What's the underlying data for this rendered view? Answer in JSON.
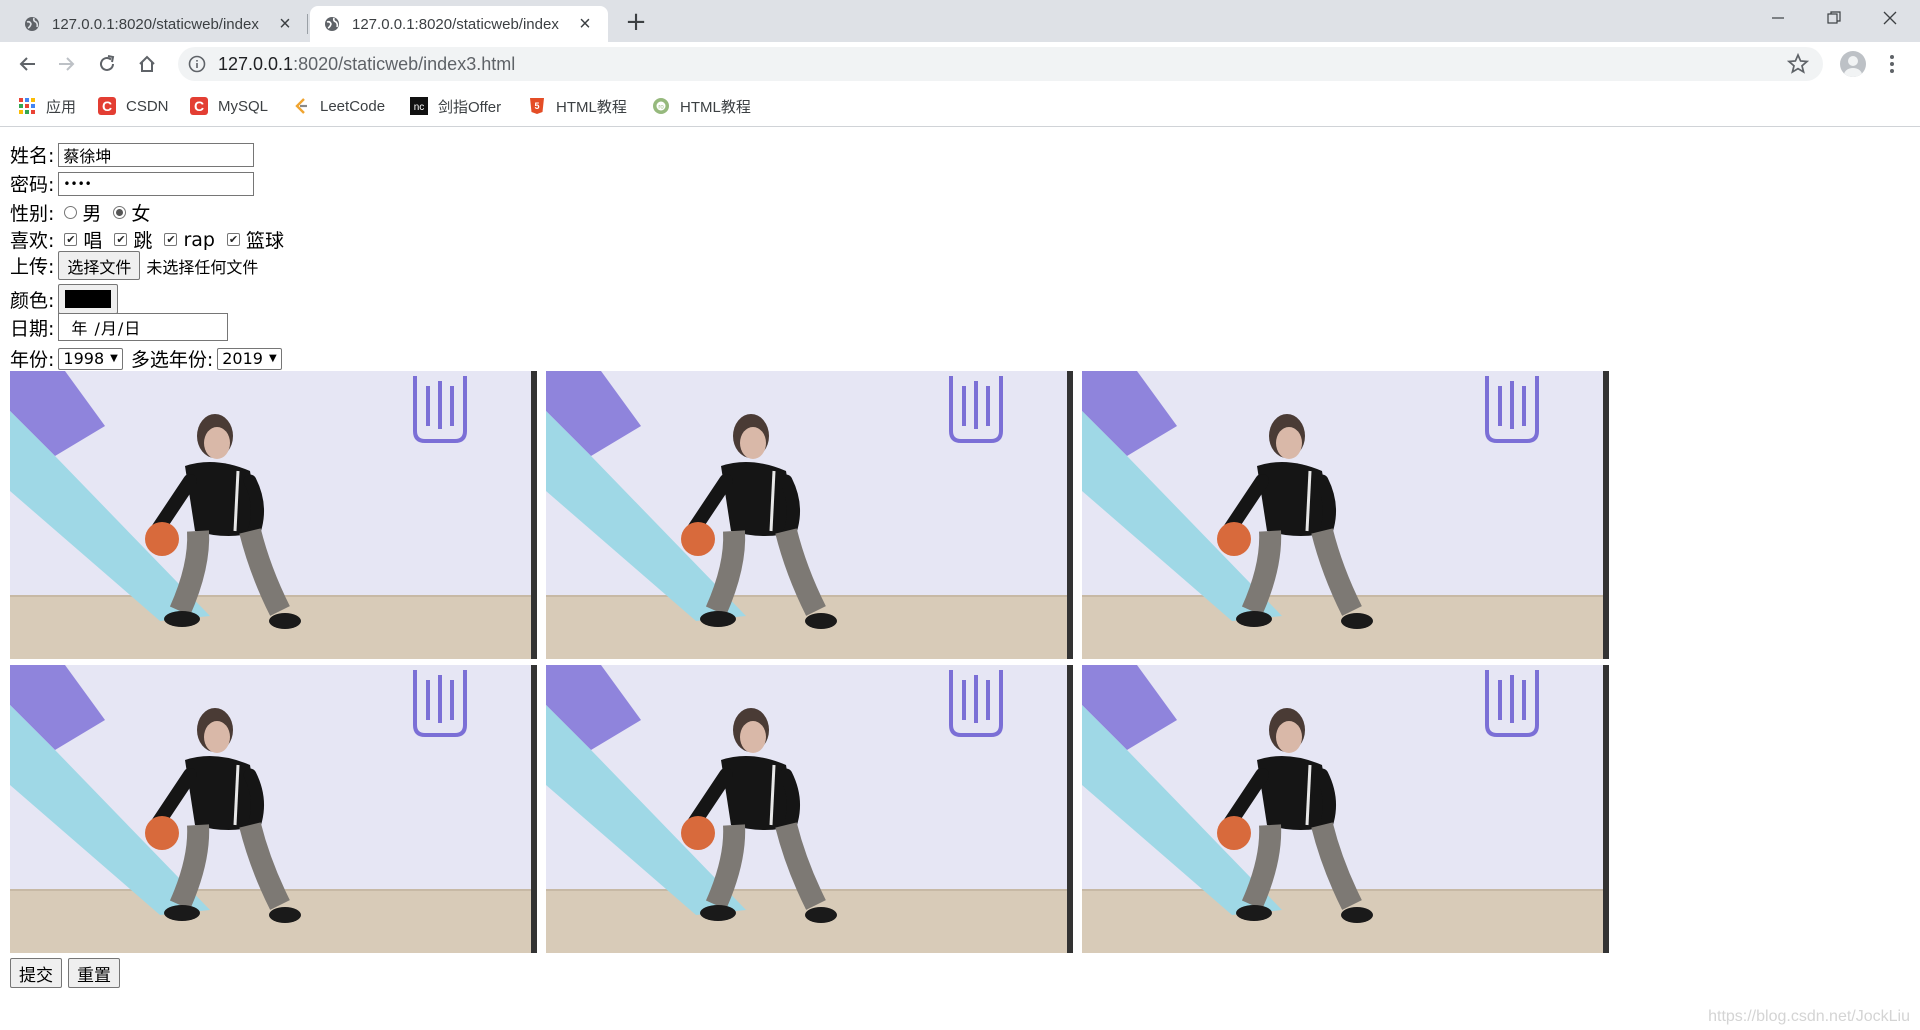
{
  "browser": {
    "tabs": [
      {
        "title": "127.0.0.1:8020/staticweb/index",
        "active": false
      },
      {
        "title": "127.0.0.1:8020/staticweb/index",
        "active": true
      }
    ],
    "url_host": "127.0.0.1",
    "url_rest": ":8020/staticweb/index3.html",
    "bookmarks": [
      {
        "label": "应用",
        "icon": "apps-grid-icon"
      },
      {
        "label": "CSDN",
        "icon": "csdn-icon"
      },
      {
        "label": "MySQL",
        "icon": "csdn-icon"
      },
      {
        "label": "LeetCode",
        "icon": "leetcode-icon"
      },
      {
        "label": "剑指Offer",
        "icon": "nowcoder-icon"
      },
      {
        "label": "HTML教程",
        "icon": "html5-icon"
      },
      {
        "label": "HTML教程",
        "icon": "runoob-icon"
      }
    ]
  },
  "form": {
    "name_label": "姓名:",
    "name_value": "蔡徐坤",
    "password_label": "密码:",
    "password_mask": "••••",
    "gender_label": "性别:",
    "gender_options": [
      "男",
      "女"
    ],
    "gender_selected": "女",
    "hobby_label": "喜欢:",
    "hobbies": [
      "唱",
      "跳",
      "rap",
      "篮球"
    ],
    "upload_label": "上传:",
    "upload_button": "选择文件",
    "upload_status": "未选择任何文件",
    "color_label": "颜色:",
    "color_value": "#000000",
    "date_label": "日期:",
    "date_placeholder": "年 /月/日",
    "year_label": "年份:",
    "year_value": "1998",
    "multi_year_label": "多选年份:",
    "multi_year_value": "2019",
    "submit_label": "提交",
    "reset_label": "重置"
  },
  "watermark": "https://blog.csdn.net/JockLiu"
}
